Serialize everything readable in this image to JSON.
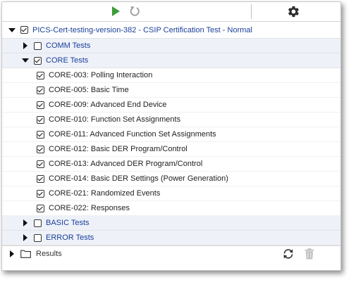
{
  "toolbar": {
    "icons": [
      "run-icon",
      "reset-icon",
      "gear-icon"
    ],
    "colors": {
      "run": "#3a9d3a",
      "reset": "#9a9a9a",
      "gear": "#2d2d2d"
    }
  },
  "root": {
    "label": "PICS-Cert-testing-version-382 - CSIP Certification Test - Normal",
    "checked": true,
    "expanded": true
  },
  "groups": {
    "comm": {
      "label": "COMM Tests",
      "checked": false,
      "expanded": false
    },
    "core": {
      "label": "CORE Tests",
      "checked": true,
      "expanded": true
    },
    "basic": {
      "label": "BASIC Tests",
      "checked": false,
      "expanded": false
    },
    "error": {
      "label": "ERROR Tests",
      "checked": false,
      "expanded": false
    }
  },
  "core_tests": [
    {
      "label": "CORE-003: Polling Interaction",
      "checked": true
    },
    {
      "label": "CORE-005: Basic Time",
      "checked": true
    },
    {
      "label": "CORE-009: Advanced End Device",
      "checked": true
    },
    {
      "label": "CORE-010: Function Set Assignments",
      "checked": true
    },
    {
      "label": "CORE-011: Advanced Function Set Assignments",
      "checked": true
    },
    {
      "label": "CORE-012: Basic DER Program/Control",
      "checked": true
    },
    {
      "label": "CORE-013: Advanced DER Program/Control",
      "checked": true
    },
    {
      "label": "CORE-014: Basic DER Settings (Power Generation)",
      "checked": true
    },
    {
      "label": "CORE-021: Randomized Events",
      "checked": true
    },
    {
      "label": "CORE-022: Responses",
      "checked": true
    }
  ],
  "results": {
    "label": "Results",
    "icons": [
      "folder-icon",
      "refresh-icon",
      "trash-icon"
    ]
  }
}
